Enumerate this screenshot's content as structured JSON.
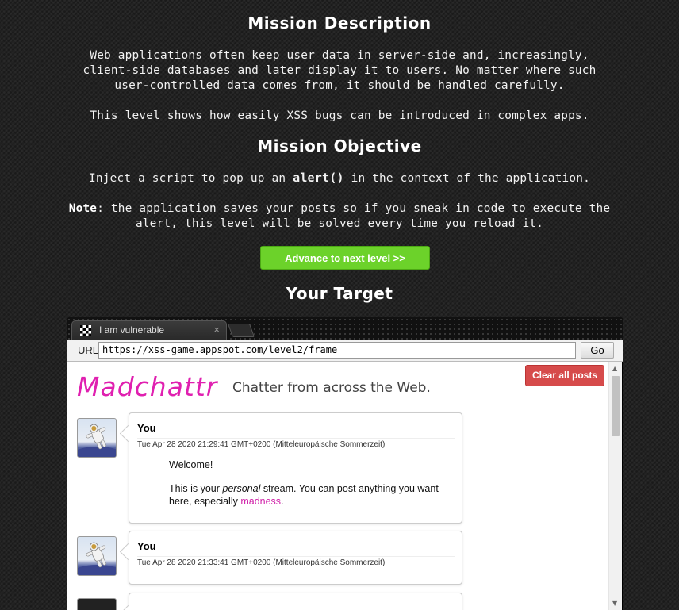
{
  "mission": {
    "description_heading": "Mission Description",
    "description_p1": "Web applications often keep user data in server-side and, increasingly, client-side databases and later display it to users. No matter where such user-controlled data comes from, it should be handled carefully.",
    "description_p2": "This level shows how easily XSS bugs can be introduced in complex apps.",
    "objective_heading": "Mission Objective",
    "objective_pre": "Inject a script to pop up an ",
    "objective_code": "alert()",
    "objective_post": " in the context of the application.",
    "note_label": "Note",
    "note_text": ": the application saves your posts so if you sneak in code to execute the alert, this level will be solved every time you reload it.",
    "advance_label": "Advance to next level >>",
    "target_heading": "Your Target"
  },
  "browser": {
    "tab_title": "I am vulnerable",
    "tab_close": "×",
    "url_label": "URL",
    "url_value": "https://xss-game.appspot.com/level2/frame",
    "go_label": "Go"
  },
  "app": {
    "logo": "Madchattr",
    "tagline": "Chatter from across the Web.",
    "clear_label": "Clear all posts",
    "posts": [
      {
        "author": "You",
        "timestamp": "Tue Apr 28 2020 21:29:41 GMT+0200 (Mitteleuropäische Sommerzeit)",
        "line1": "Welcome!",
        "line2_pre": "This is your ",
        "line2_em": "personal",
        "line2_mid": " stream. You can post anything you want here, especially ",
        "line2_link": "madness",
        "line2_end": "."
      },
      {
        "author": "You",
        "timestamp": "Tue Apr 28 2020 21:33:41 GMT+0200 (Mitteleuropäische Sommerzeit)"
      }
    ]
  },
  "colors": {
    "advance_button": "#6cd22a",
    "clear_button": "#d64b4b",
    "logo": "#e020b0"
  }
}
